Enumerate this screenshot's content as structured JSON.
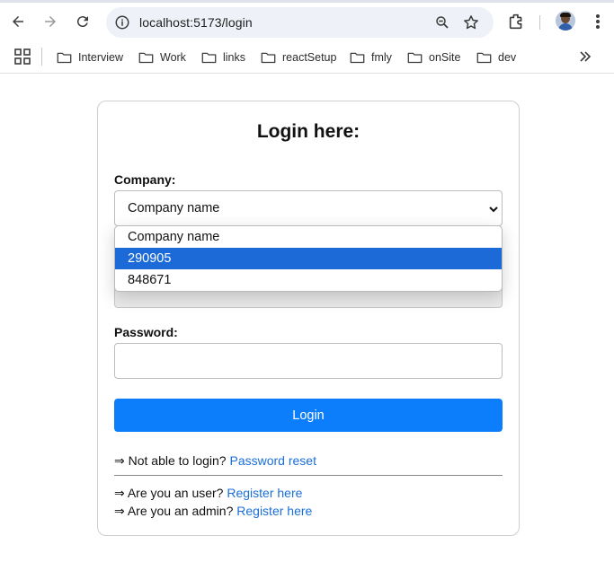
{
  "browser": {
    "url": "localhost:5173/login",
    "bookmarks": [
      "Interview",
      "Work",
      "links",
      "reactSetup",
      "fmly",
      "onSite",
      "dev"
    ]
  },
  "login": {
    "title": "Login here:",
    "company_label": "Company:",
    "company_value": "Company name",
    "password_label": "Password:",
    "login_button": "Login",
    "reset_prefix": "⇒ Not able to login? ",
    "reset_link": "Password reset",
    "user_prefix": "⇒ Are you an user? ",
    "user_link": "Register here",
    "admin_prefix": "⇒ Are you an admin? ",
    "admin_link": "Register here"
  },
  "dropdown": {
    "options": [
      "Company name",
      "290905",
      "848671"
    ],
    "highlighted_option": "290905"
  },
  "colors": {
    "accent": "#0d7efb",
    "link": "#1a6fd8",
    "highlight": "#1b6ad8"
  }
}
